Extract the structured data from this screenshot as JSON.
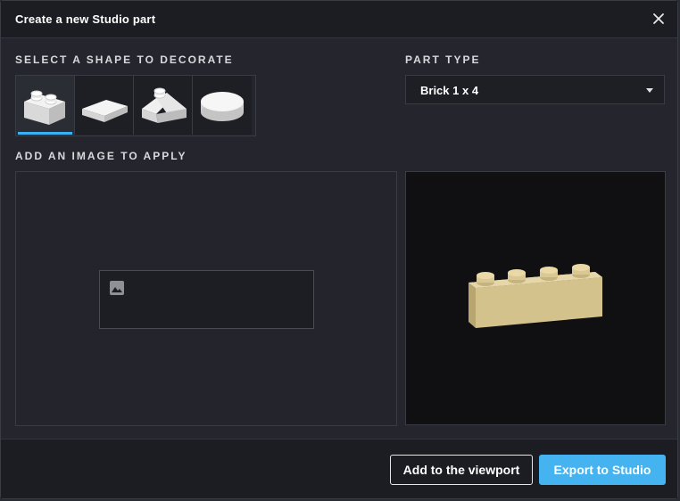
{
  "dialog": {
    "title": "Create a new Studio part",
    "close_icon": "close-icon"
  },
  "shape_section": {
    "label": "SELECT A SHAPE TO DECORATE",
    "shapes": [
      {
        "name": "brick-icon",
        "selected": true
      },
      {
        "name": "tile-icon",
        "selected": false
      },
      {
        "name": "slope-icon",
        "selected": false
      },
      {
        "name": "round-tile-icon",
        "selected": false
      }
    ],
    "selected_indicator_color": "#3ab0f5"
  },
  "part_type": {
    "label": "PART TYPE",
    "value": "Brick 1 x 4"
  },
  "image_section": {
    "label": "ADD AN IMAGE TO APPLY",
    "dropzone_icon": "image-icon"
  },
  "preview": {
    "brick_color": "#d8c58f"
  },
  "footer": {
    "add_label": "Add to the viewport",
    "export_label": "Export to Studio",
    "export_color": "#45b3f0"
  }
}
